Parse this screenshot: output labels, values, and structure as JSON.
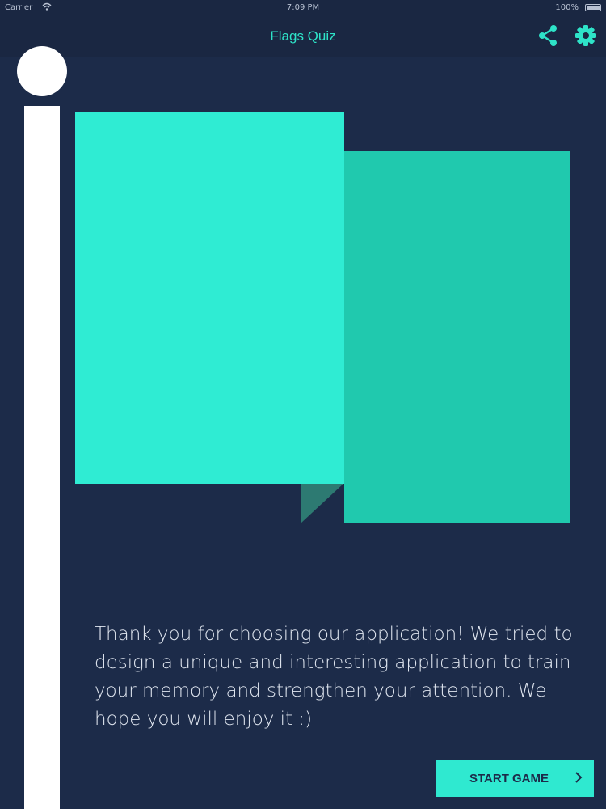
{
  "status_bar": {
    "carrier": "Carrier",
    "time": "7:09 PM",
    "battery": "100%",
    "wifi_icon": "wifi-icon",
    "battery_icon": "battery-icon"
  },
  "nav": {
    "title": "Flags Quiz",
    "share_icon": "share-icon",
    "settings_icon": "gear-icon"
  },
  "main": {
    "message": "Thank you for choosing our application! We tried to design a unique and interesting application to train your memory and strengthen your attention. We hope you will enjoy it :)",
    "start_button_label": "START GAME",
    "start_button_icon": "chevron-right-icon"
  },
  "colors": {
    "background": "#1c2b49",
    "accent": "#2fecd3",
    "accent_dark": "#20c9ae",
    "pole": "#ffffff",
    "text": "#dfe5ef"
  }
}
